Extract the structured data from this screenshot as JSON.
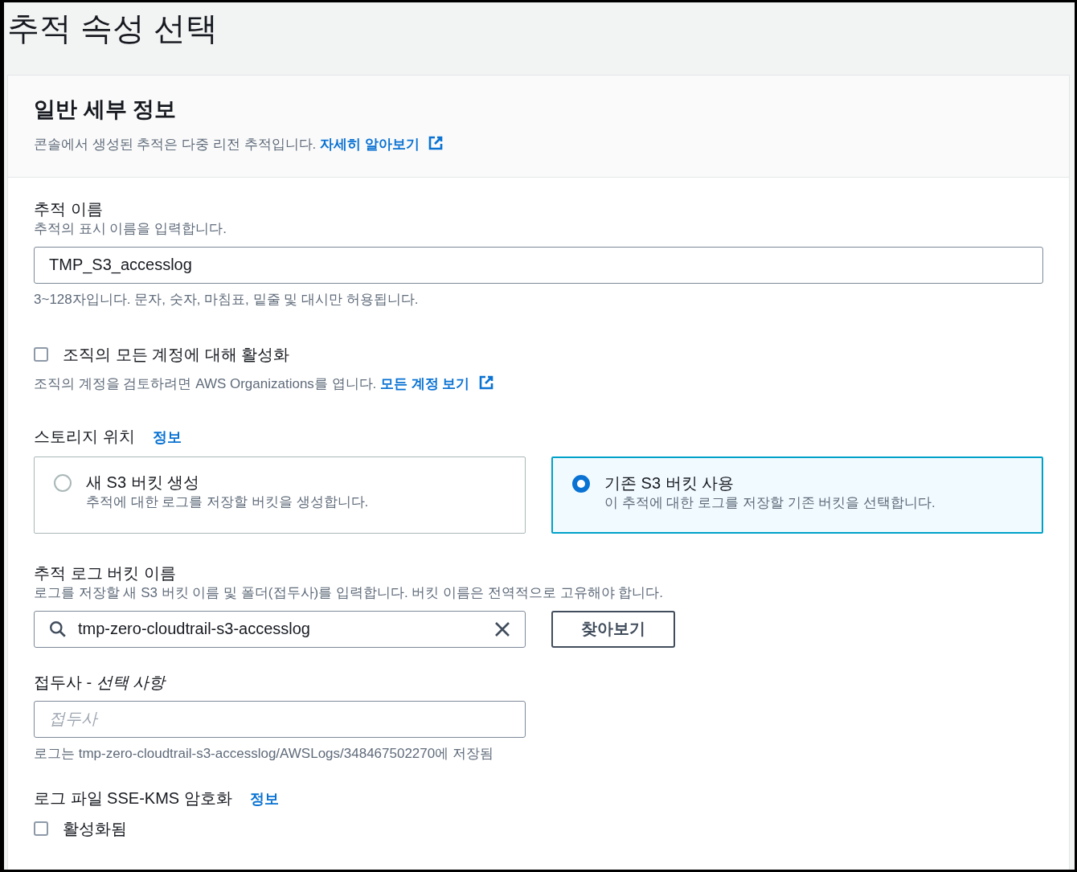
{
  "page_title": "추적 속성 선택",
  "general": {
    "title": "일반 세부 정보",
    "description": "콘솔에서 생성된 추적은 다중 리전 추적입니다.",
    "link": "자세히 알아보기"
  },
  "trail_name": {
    "label": "추적 이름",
    "description": "추적의 표시 이름을 입력합니다.",
    "value": "TMP_S3_accesslog",
    "constraint": "3~128자입니다. 문자, 숫자, 마침표, 밑줄 및 대시만 허용됩니다."
  },
  "organization": {
    "label": "조직의 모든 계정에 대해 활성화",
    "checked": false,
    "description": "조직의 계정을 검토하려면 AWS Organizations를 엽니다.",
    "link": "모든 계정 보기"
  },
  "storage": {
    "label": "스토리지 위치",
    "info": "정보",
    "options": [
      {
        "title": "새 S3 버킷 생성",
        "description": "추적에 대한 로그를 저장할 버킷을 생성합니다.",
        "selected": false
      },
      {
        "title": "기존 S3 버킷 사용",
        "description": "이 추적에 대한 로그를 저장할 기존 버킷을 선택합니다.",
        "selected": true
      }
    ]
  },
  "bucket": {
    "label": "추적 로그 버킷 이름",
    "description": "로그를 저장할 새 S3 버킷 이름 및 폴더(접두사)를 입력합니다. 버킷 이름은 전역적으로 고유해야 합니다.",
    "value": "tmp-zero-cloudtrail-s3-accesslog",
    "browse_button": "찾아보기"
  },
  "prefix": {
    "label": "접두사 - *선택 사항*",
    "placeholder": "접두사",
    "hint": "로그는 tmp-zero-cloudtrail-s3-accesslog/AWSLogs/348467502270에 저장됨"
  },
  "encryption": {
    "label": "로그 파일 SSE-KMS 암호화",
    "info": "정보",
    "checkbox_label": "활성화됨",
    "checked": false
  }
}
